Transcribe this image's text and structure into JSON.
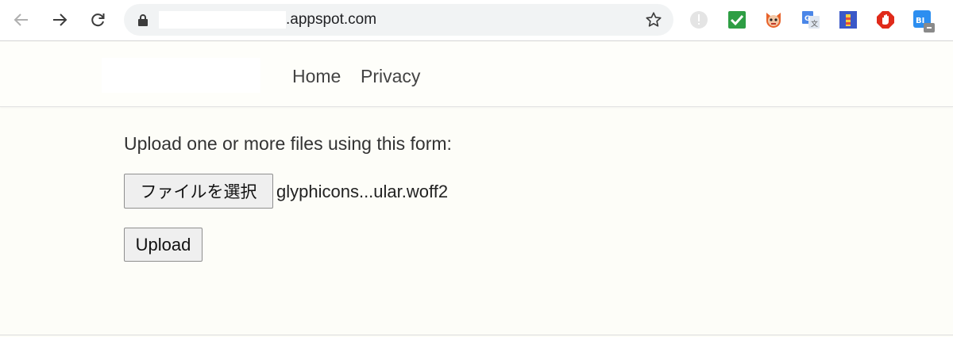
{
  "browser": {
    "url_suffix": ".appspot.com",
    "icons": {
      "back": "arrow-left-icon",
      "forward": "arrow-right-icon",
      "reload": "reload-icon",
      "lock": "lock-icon",
      "bookmark": "star-icon"
    },
    "extensions": [
      {
        "name": "alert-extension-icon",
        "color": "#bdbdbd"
      },
      {
        "name": "checkmark-extension-icon",
        "color": "#2e9e44"
      },
      {
        "name": "cat-extension-icon",
        "color": "#d9442b"
      },
      {
        "name": "translate-extension-icon",
        "color": "#4a86e8"
      },
      {
        "name": "lighthouse-extension-icon",
        "color": "#3a58c8"
      },
      {
        "name": "stop-hand-extension-icon",
        "color": "#e02a1a"
      },
      {
        "name": "bi-extension-icon",
        "color": "#2c8ef0",
        "text": "BI"
      }
    ]
  },
  "navbar": {
    "links": [
      {
        "label": "Home"
      },
      {
        "label": "Privacy"
      }
    ]
  },
  "main": {
    "intro": "Upload one or more files using this form:",
    "choose_file_label": "ファイルを選択",
    "selected_file": "glyphicons...ular.woff2",
    "upload_label": "Upload"
  }
}
